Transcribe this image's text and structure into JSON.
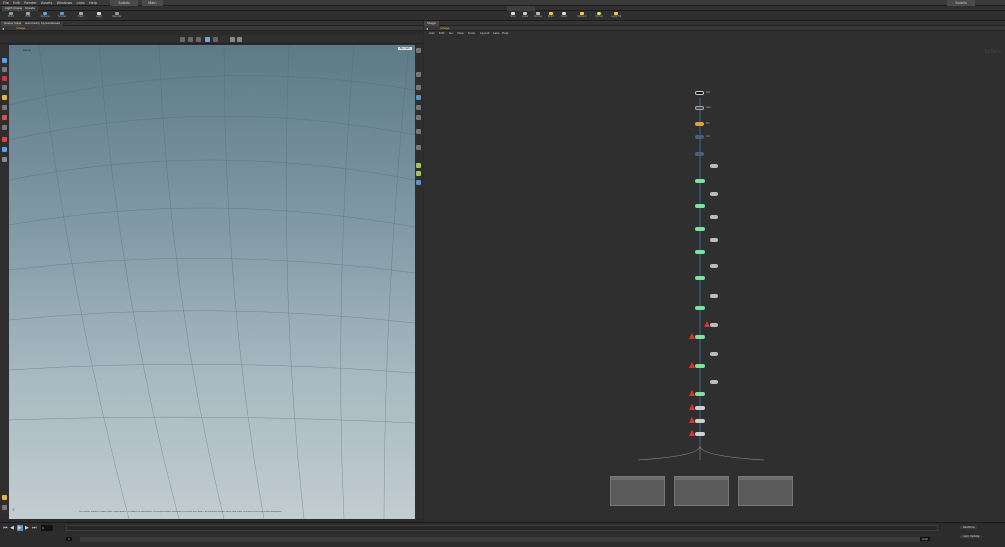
{
  "menubar": {
    "items": [
      "File",
      "Edit",
      "Render",
      "Assets",
      "Windows",
      "Labs",
      "Help"
    ],
    "desktop": "Solaris",
    "build": "Main"
  },
  "shelf_tabs": [
    "Light Inspector",
    "Create"
  ],
  "shelf_tools": [
    "Point",
    "Edit",
    "Sphere",
    "Scene",
    "Cam",
    "Light",
    "Render"
  ],
  "lop_tools": [
    "Sun",
    "Area",
    "Dome",
    "Point",
    "Spot",
    "Distant",
    "Portal",
    "Light Mixer"
  ],
  "left_pane": {
    "tabs": [
      "Scene View",
      "Geometry Spreadsheet"
    ],
    "path": "/stage",
    "view_label": "Persp",
    "cam_label": "No cam",
    "status_text": "Left mouse tumbles. Middle pans. Right dollies. Ctrl+Alt+Left box-zooms. Ctrl+Right zooms. Spacebar+Ctrl+Left tilts. Hold L for alternate tumble, dolly, and zoom.    M or Alt+M for First Person Navigation."
  },
  "right_pane": {
    "tabs": [
      "Stage"
    ],
    "path": "/stage",
    "menu": [
      "Add",
      "Edit",
      "Go",
      "View",
      "Tools",
      "Layout",
      "Labs",
      "Help"
    ],
    "context_label": "Solaris"
  },
  "network": {
    "top_nodes": [
      "Ref",
      "Geo",
      "Mtl",
      "Var"
    ],
    "chain_count": 18,
    "subnets": [
      "",
      "",
      ""
    ]
  },
  "timeline": {
    "frame": "1",
    "start": "1",
    "end": "240",
    "realtime": "Realtime",
    "auto_update": "Auto Update"
  },
  "colors": {
    "node_green": "#7fe39b",
    "node_yellow": "#d6a23a",
    "warn_red": "#d33838",
    "wire_blue": "#3c78a8"
  }
}
